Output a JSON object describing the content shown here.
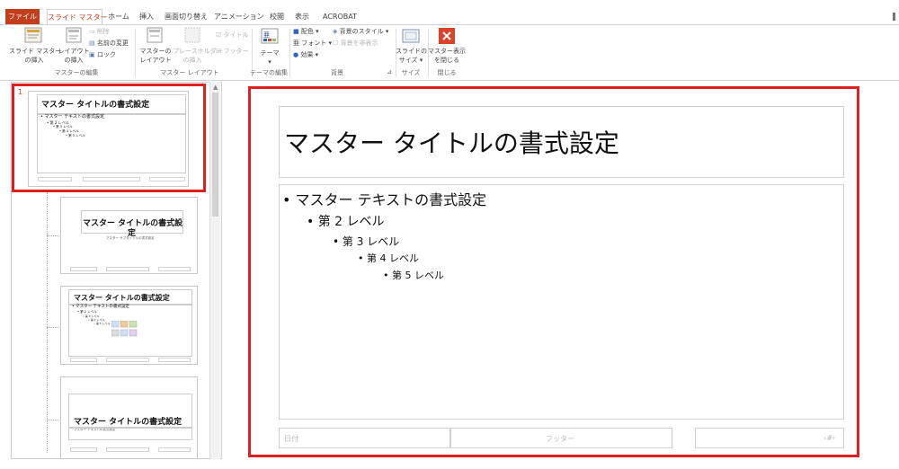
{
  "tabs": [
    "ファイル",
    "スライド マスター",
    "ホーム",
    "挿入",
    "画面切り替え",
    "アニメーション",
    "校閲",
    "表示",
    "ACROBAT"
  ],
  "ribbon": {
    "insert_master": [
      "スライド マスター",
      "の挿入"
    ],
    "insert_layout": [
      "レイアウト",
      "の挿入"
    ],
    "delete": "削除",
    "rename": "名前の変更",
    "lock": "ロック",
    "group_master_edit": "マスターの編集",
    "master_layout": [
      "マスターの",
      "レイアウト"
    ],
    "placeholder_insert": [
      "プレースホルダー",
      "の挿入"
    ],
    "title_chk": "タイトル",
    "footer_chk": "フッター",
    "group_master_layout": "マスター レイアウト",
    "theme": "テーマ",
    "group_theme_edit": "テーマの編集",
    "colors": "配色",
    "fonts": "フォント",
    "effects": "効果",
    "bg_styles": "背景のスタイル",
    "hide_bg": "背景を非表示",
    "group_background": "背景",
    "slide_size": [
      "スライドの",
      "サイズ"
    ],
    "group_size": "サイズ",
    "close_master": [
      "マスター表示",
      "を閉じる"
    ],
    "group_close": "閉じる"
  },
  "thumbs": {
    "number": "1",
    "t1_title": "マスター タイトルの書式設定",
    "t1_lines": [
      "• マスター テキストの書式設定",
      "• 第 2 レベル",
      "• 第 3 レベル",
      "• 第 4 レベル",
      "• 第 5 レベル"
    ],
    "t2_title_l1": "マスター タイトルの書式設",
    "t2_title_l2": "定",
    "t2_sub": "マスター サブタイトルの書式設定",
    "t3_title": "マスター タイトルの書式設定",
    "t3_lines": [
      "• マスター テキストの書式設定",
      "• 第 2 レベル",
      "• 第 3 レベル",
      "• 第 4 レベル",
      "• 第 5 レベル"
    ],
    "t4_title": "マスター タイトルの書式設定",
    "t4_sub": "マスター テキストの書式設定"
  },
  "slide": {
    "title": "マスター タイトルの書式設定",
    "levels": [
      "• マスター テキストの書式設定",
      "• 第 2 レベル",
      "• 第 3 レベル",
      "• 第 4 レベル",
      "• 第 5 レベル"
    ],
    "date": "日付",
    "footer": "フッター",
    "number": "‹#›"
  },
  "colors": {
    "accent": "#c43e1c",
    "highlight": "#e02020"
  }
}
